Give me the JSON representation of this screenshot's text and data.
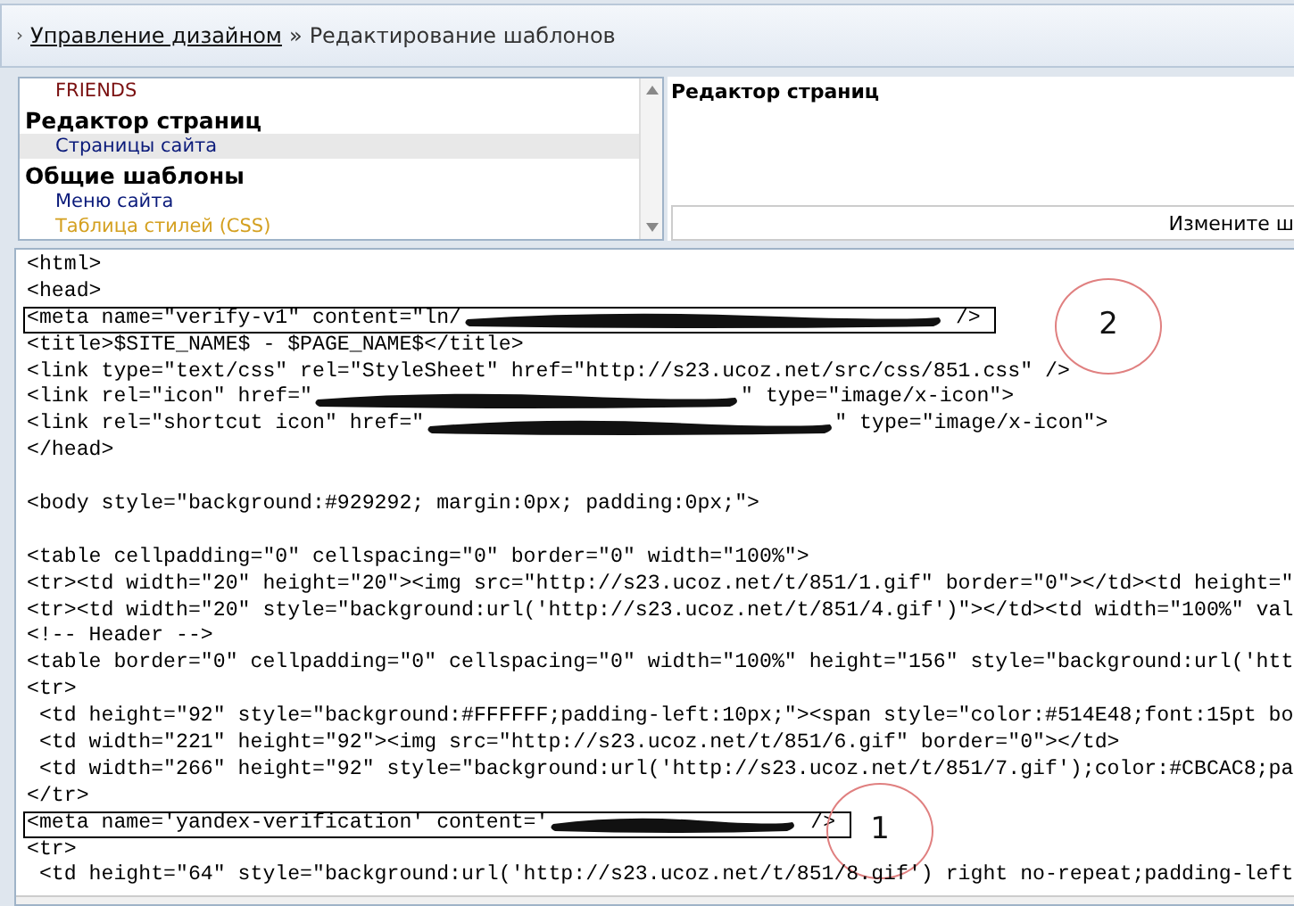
{
  "breadcrumb": {
    "marker": "›",
    "link": "Управление дизайном",
    "separator": "»",
    "current": "Редактирование шаблонов"
  },
  "template_list": [
    {
      "kind": "item",
      "label": "FRIENDS",
      "color": "#7a1010",
      "selected": false
    },
    {
      "kind": "heading",
      "label": "Редактор страниц"
    },
    {
      "kind": "item",
      "label": "Страницы сайта",
      "color": "#0a1a7a",
      "selected": true
    },
    {
      "kind": "heading",
      "label": "Общие шаблоны"
    },
    {
      "kind": "item",
      "label": "Меню сайта",
      "color": "#0a1a7a",
      "selected": false
    },
    {
      "kind": "item",
      "label": "Таблица стилей (CSS)",
      "color": "#d4a020",
      "selected": false
    }
  ],
  "info_panel": {
    "title": "Редактор страниц",
    "hint": "Измените ш"
  },
  "code_lines": [
    {
      "parts": [
        {
          "kind": "text",
          "text": "<html>"
        }
      ]
    },
    {
      "parts": [
        {
          "kind": "text",
          "text": "<head>"
        }
      ]
    },
    {
      "boxed": true,
      "marker": "2",
      "parts": [
        {
          "kind": "text",
          "text": "<meta name=\"verify-v1\" content=\"ln/"
        },
        {
          "kind": "redaction"
        },
        {
          "kind": "text",
          "text": " />"
        }
      ]
    },
    {
      "parts": [
        {
          "kind": "text",
          "text": "<title>$SITE_NAME$ - $PAGE_NAME$</title>"
        }
      ]
    },
    {
      "parts": [
        {
          "kind": "text",
          "text": "<link type=\"text/css\" rel=\"StyleSheet\" href=\"http://s23.ucoz.net/src/css/851.css\" />"
        }
      ]
    },
    {
      "parts": [
        {
          "kind": "text",
          "text": "<link rel=\"icon\" href=\""
        },
        {
          "kind": "redaction"
        },
        {
          "kind": "text",
          "text": "\" type=\"image/x-icon\">"
        }
      ]
    },
    {
      "parts": [
        {
          "kind": "text",
          "text": "<link rel=\"shortcut icon\" href=\""
        },
        {
          "kind": "redaction"
        },
        {
          "kind": "text",
          "text": "\" type=\"image/x-icon\">"
        }
      ]
    },
    {
      "parts": [
        {
          "kind": "text",
          "text": "</head>"
        }
      ]
    },
    {
      "gap_before": true,
      "parts": [
        {
          "kind": "text",
          "text": "<body style=\"background:#929292; margin:0px; padding:0px;\">"
        }
      ]
    },
    {
      "gap_before": true,
      "parts": [
        {
          "kind": "text",
          "text": "<table cellpadding=\"0\" cellspacing=\"0\" border=\"0\" width=\"100%\">"
        }
      ]
    },
    {
      "parts": [
        {
          "kind": "text",
          "text": "<tr><td width=\"20\" height=\"20\"><img src=\"http://s23.ucoz.net/t/851/1.gif\" border=\"0\"></td><td height=\""
        }
      ]
    },
    {
      "parts": [
        {
          "kind": "text",
          "text": "<tr><td width=\"20\" style=\"background:url('http://s23.ucoz.net/t/851/4.gif')\"></td><td width=\"100%\" val"
        }
      ]
    },
    {
      "parts": [
        {
          "kind": "text",
          "text": "<!-- Header -->"
        }
      ]
    },
    {
      "parts": [
        {
          "kind": "text",
          "text": "<table border=\"0\" cellpadding=\"0\" cellspacing=\"0\" width=\"100%\" height=\"156\" style=\"background:url('htt"
        }
      ]
    },
    {
      "parts": [
        {
          "kind": "text",
          "text": "<tr>"
        }
      ]
    },
    {
      "parts": [
        {
          "kind": "text",
          "text": " <td height=\"92\" style=\"background:#FFFFFF;padding-left:10px;\"><span style=\"color:#514E48;font:15pt bo"
        }
      ]
    },
    {
      "parts": [
        {
          "kind": "text",
          "text": " <td width=\"221\" height=\"92\"><img src=\"http://s23.ucoz.net/t/851/6.gif\" border=\"0\"></td>"
        }
      ]
    },
    {
      "parts": [
        {
          "kind": "text",
          "text": " <td width=\"266\" height=\"92\" style=\"background:url('http://s23.ucoz.net/t/851/7.gif');color:#CBCAC8;pa"
        }
      ]
    },
    {
      "parts": [
        {
          "kind": "text",
          "text": "</tr>"
        }
      ]
    },
    {
      "boxed": true,
      "marker": "1",
      "parts": [
        {
          "kind": "text",
          "text": "<meta name='yandex-verification' content='"
        },
        {
          "kind": "redaction"
        },
        {
          "kind": "text",
          "text": " />"
        }
      ]
    },
    {
      "parts": [
        {
          "kind": "text",
          "text": "<tr>"
        }
      ]
    },
    {
      "parts": [
        {
          "kind": "text",
          "text": " <td height=\"64\" style=\"background:url('http://s23.ucoz.net/t/851/8.gif') right no-repeat;padding-left"
        }
      ]
    }
  ]
}
